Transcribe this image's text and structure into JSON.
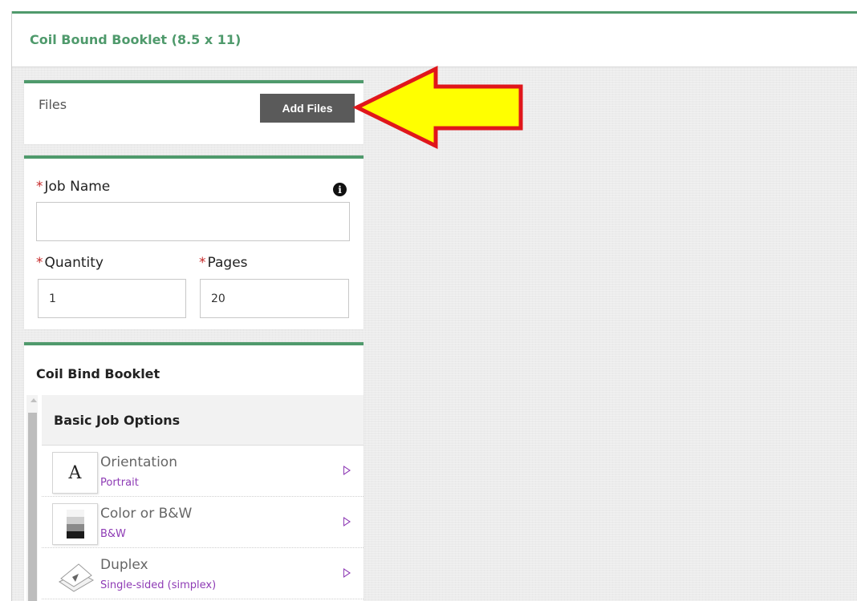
{
  "header": {
    "title": "Coil Bound Booklet (8.5 x 11)"
  },
  "files_panel": {
    "label": "Files",
    "add_files_label": "Add Files"
  },
  "job_panel": {
    "job_name": {
      "label": "Job Name",
      "value": "",
      "required_mark": "*"
    },
    "quantity": {
      "label": "Quantity",
      "value": "1",
      "required_mark": "*"
    },
    "pages": {
      "label": "Pages",
      "value": "20",
      "required_mark": "*"
    },
    "info_icon": "info-icon"
  },
  "options_panel": {
    "title": "Coil Bind Booklet",
    "section_title": "Basic Job Options",
    "options": [
      {
        "name": "Orientation",
        "value": "Portrait",
        "icon": "letter-a-icon"
      },
      {
        "name": "Color or B&W",
        "value": "B&W",
        "icon": "grayscale-swatch-icon"
      },
      {
        "name": "Duplex",
        "value": "Single-sided (simplex)",
        "icon": "duplex-paper-icon"
      }
    ]
  },
  "colors": {
    "accent_green": "#4f9a6c",
    "button_gray": "#5a5a5a",
    "option_value_purple": "#8e3bb5",
    "required_red": "#c62828",
    "callout_yellow": "#ffff00",
    "callout_outline": "#e0161b"
  },
  "annotation": {
    "icon": "yellow-arrow-callout-icon"
  }
}
